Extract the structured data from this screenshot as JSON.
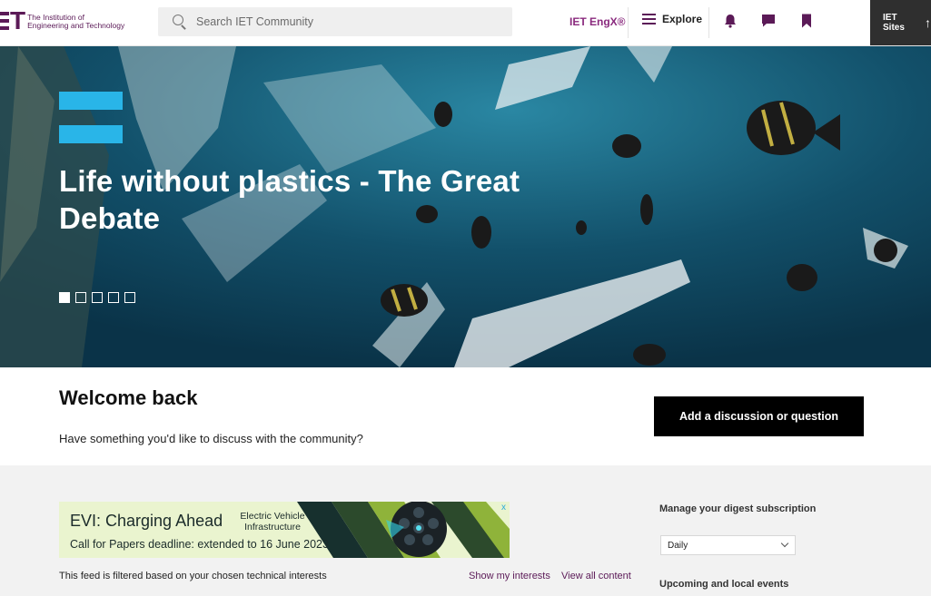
{
  "header": {
    "logo_text_line1": "The Institution of",
    "logo_text_line2": "Engineering and Technology",
    "logo_mark": "ET",
    "search_placeholder": "Search IET Community",
    "engx_label": "IET EngX®",
    "explore_label": "Explore",
    "sites_label": "IET Sites",
    "icons": [
      "bell-icon",
      "chat-icon",
      "bookmark-icon",
      "arrow-up-icon"
    ]
  },
  "hero": {
    "title": "Life without plastics - The Great Debate",
    "slide_count": 5,
    "active_slide": 1
  },
  "welcome": {
    "title": "Welcome back",
    "prompt": "Have something you'd like to discuss with the community?",
    "add_button": "Add a discussion or question"
  },
  "ad": {
    "title": "EVI: Charging Ahead",
    "subtitle_line1": "Electric Vehicle",
    "subtitle_line2": "Infrastructure",
    "cfp": "Call for Papers deadline: extended to 16 June 2023",
    "close": "x"
  },
  "feed": {
    "filter_note": "This feed is filtered based on your chosen technical interests",
    "show_interests": "Show my interests",
    "view_all": "View all content"
  },
  "sidebar": {
    "digest_title": "Manage your digest subscription",
    "digest_value": "Daily",
    "events_title": "Upcoming and local events"
  },
  "colors": {
    "brand_purple": "#5b1a57",
    "accent_blue": "#29b5e8",
    "engx_purple": "#8a2a7e"
  }
}
